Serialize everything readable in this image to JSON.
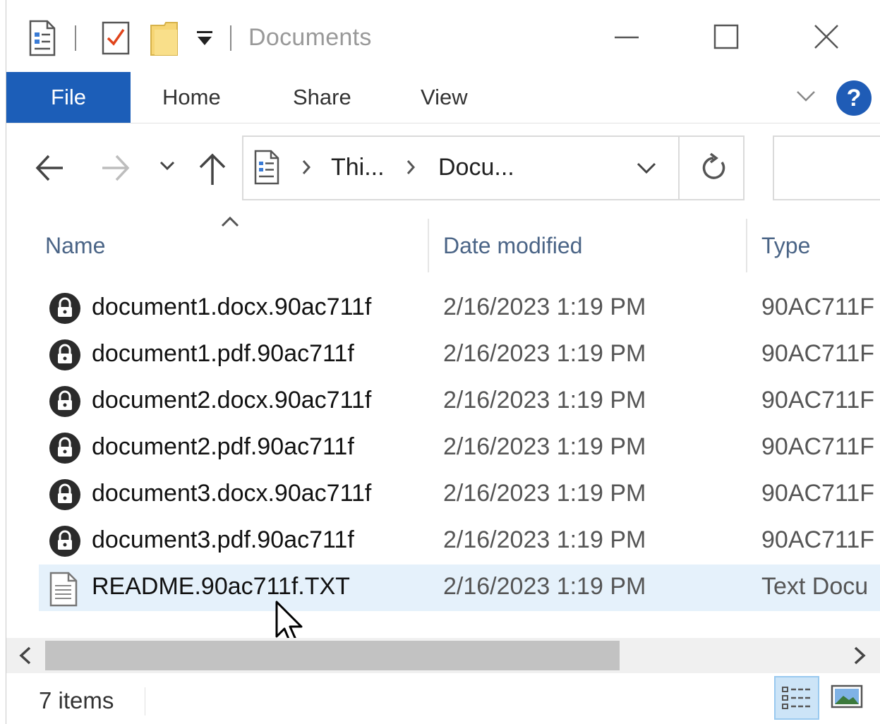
{
  "window": {
    "title": "Documents"
  },
  "ribbon": {
    "tabs": [
      {
        "label": "File"
      },
      {
        "label": "Home"
      },
      {
        "label": "Share"
      },
      {
        "label": "View"
      }
    ],
    "help_label": "?"
  },
  "address_bar": {
    "segments": [
      "Thi...",
      "Docu..."
    ]
  },
  "columns": {
    "name": "Name",
    "date": "Date modified",
    "type": "Type"
  },
  "files": [
    {
      "name": "document1.docx.90ac711f",
      "date": "2/16/2023 1:19 PM",
      "type": "90AC711F",
      "icon": "lock-icon"
    },
    {
      "name": "document1.pdf.90ac711f",
      "date": "2/16/2023 1:19 PM",
      "type": "90AC711F",
      "icon": "lock-icon"
    },
    {
      "name": "document2.docx.90ac711f",
      "date": "2/16/2023 1:19 PM",
      "type": "90AC711F",
      "icon": "lock-icon"
    },
    {
      "name": "document2.pdf.90ac711f",
      "date": "2/16/2023 1:19 PM",
      "type": "90AC711F",
      "icon": "lock-icon"
    },
    {
      "name": "document3.docx.90ac711f",
      "date": "2/16/2023 1:19 PM",
      "type": "90AC711F",
      "icon": "lock-icon"
    },
    {
      "name": "document3.pdf.90ac711f",
      "date": "2/16/2023 1:19 PM",
      "type": "90AC711F",
      "icon": "lock-icon"
    },
    {
      "name": "README.90ac711f.TXT",
      "date": "2/16/2023 1:19 PM",
      "type": "Text Docu",
      "icon": "text-file-icon",
      "selected": true
    }
  ],
  "status_bar": {
    "item_count": "7 items"
  },
  "colors": {
    "file_tab": "#1c5eb8",
    "selection": "#e5f1fb",
    "header_text": "#4a6486"
  }
}
